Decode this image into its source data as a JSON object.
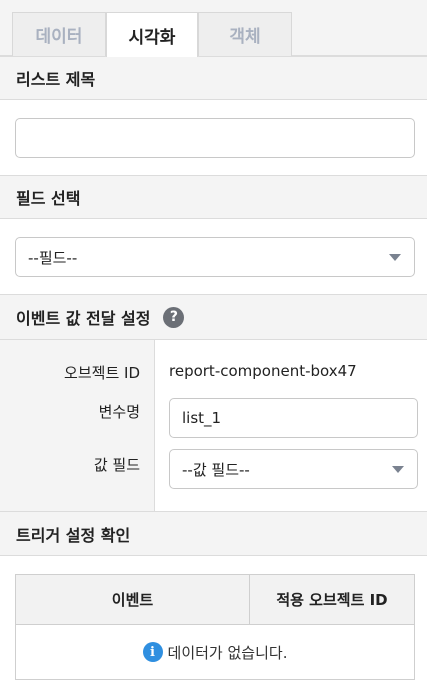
{
  "tabs": [
    {
      "label": "데이터",
      "active": false
    },
    {
      "label": "시각화",
      "active": true
    },
    {
      "label": "객체",
      "active": false
    }
  ],
  "list_title": {
    "heading": "리스트 제목",
    "value": ""
  },
  "field_select": {
    "heading": "필드 선택",
    "selected": "--필드--"
  },
  "event_settings": {
    "heading": "이벤트 값 전달 설정",
    "help_icon": "question-circle-icon",
    "object_id_label": "오브젝트 ID",
    "object_id_value": "report-component-box47",
    "variable_label": "변수명",
    "variable_value": "list_1",
    "value_field_label": "값 필드",
    "value_field_selected": "--값 필드--"
  },
  "trigger": {
    "heading": "트리거 설정 확인",
    "columns": [
      "이벤트",
      "적용 오브젝트 ID"
    ],
    "empty_message": "데이터가 없습니다.",
    "info_icon": "info-circle-icon"
  },
  "colors": {
    "accent_info": "#2f8fe0",
    "inactive_tab_text": "#a9b1c0",
    "section_bg": "#f4f4f4"
  }
}
